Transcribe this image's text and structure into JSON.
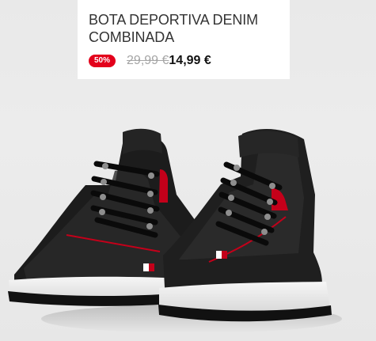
{
  "product": {
    "title": "BOTA DEPORTIVA DENIM COMBINADA",
    "discount_badge": "50%",
    "old_price": "29,99 €",
    "sale_price": "14,99 €"
  },
  "colors": {
    "background": "#ececec",
    "card": "#ffffff",
    "title": "#333333",
    "badge": "#e3001b",
    "old_price": "#a5a5a5",
    "sale_price": "#111111",
    "shoe": "#1b1b1b",
    "accent": "#c4001a"
  }
}
